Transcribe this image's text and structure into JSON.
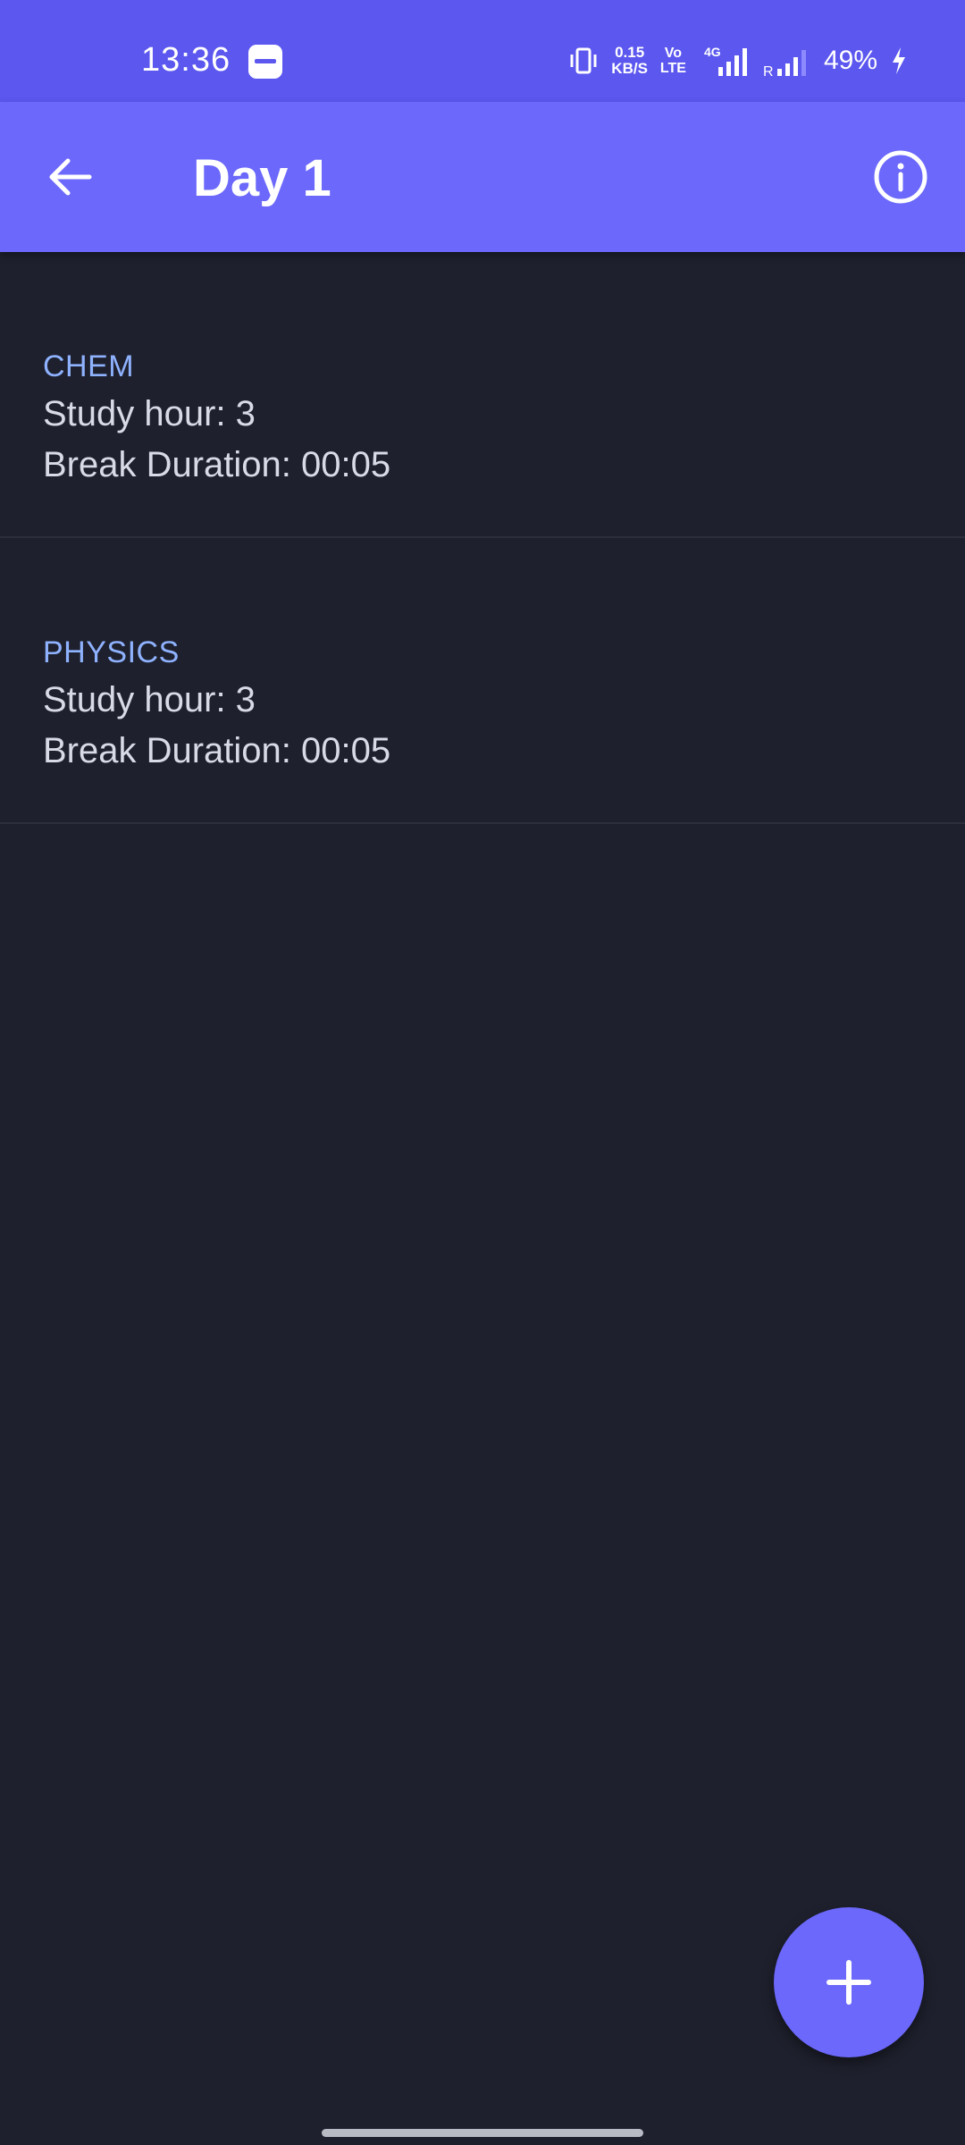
{
  "status_bar": {
    "time": "13:36",
    "net_speed_value": "0.15",
    "net_speed_unit": "KB/S",
    "volte_top": "Vo",
    "volte_bottom": "LTE",
    "network_type": "4G",
    "roaming": "R",
    "battery": "49%",
    "icons": [
      "app-notification-icon",
      "vibrate-icon",
      "signal-icon",
      "charging-icon"
    ]
  },
  "app_bar": {
    "title": "Day 1",
    "back_icon": "arrow-left-icon",
    "info_icon": "info-icon"
  },
  "subjects": [
    {
      "name": "CHEM",
      "study_hour": "Study hour: 3",
      "break_duration": "Break Duration: 00:05"
    },
    {
      "name": "PHYSICS",
      "study_hour": "Study hour: 3",
      "break_duration": "Break Duration: 00:05"
    }
  ],
  "fab": {
    "icon": "plus-icon"
  },
  "colors": {
    "status_bar": "#5b57ef",
    "app_bar": "#6b68fb",
    "background": "#1e202d",
    "subject_label": "#8fb2ff",
    "body_text": "#d8dae6"
  }
}
